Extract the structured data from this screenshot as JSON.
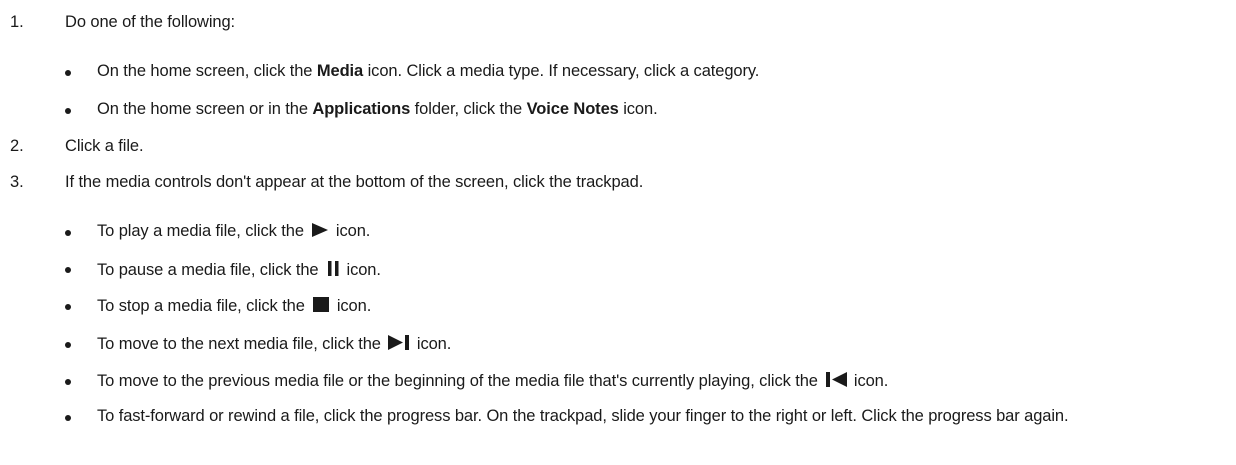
{
  "steps": [
    {
      "num": "1.",
      "text": "Do one of the following:"
    },
    {
      "num": "2.",
      "text": "Click a file."
    },
    {
      "num": "3.",
      "text": "If the media controls don't appear at the bottom of the screen, click the trackpad."
    }
  ],
  "step1_bullets": {
    "b1": {
      "t1": "On the home screen, click the ",
      "bold1": "Media",
      "t2": " icon. Click a media type. If necessary, click a category."
    },
    "b2": {
      "t1": "On the home screen or in the ",
      "bold1": "Applications",
      "t2": " folder, click the ",
      "bold2": "Voice Notes",
      "t3": " icon."
    }
  },
  "step3_bullets": {
    "play": {
      "before": "To play a media file, click the",
      "after": "icon.",
      "icon": "play-icon"
    },
    "pause": {
      "before": "To pause a media file, click the",
      "after": "icon.",
      "icon": "pause-icon"
    },
    "stop": {
      "before": "To stop a media file, click the",
      "after": "icon.",
      "icon": "stop-icon"
    },
    "next": {
      "before": "To move to the next media file, click the",
      "after": "icon.",
      "icon": "next-track-icon"
    },
    "prev": {
      "before": "To move to the previous media file or the beginning of the media file that's currently playing, click the",
      "after": "icon.",
      "icon": "previous-track-icon"
    },
    "ff": {
      "text": "To fast-forward or rewind a file, click the progress bar. On the trackpad, slide your finger to the right or left. Click the progress bar again."
    }
  }
}
